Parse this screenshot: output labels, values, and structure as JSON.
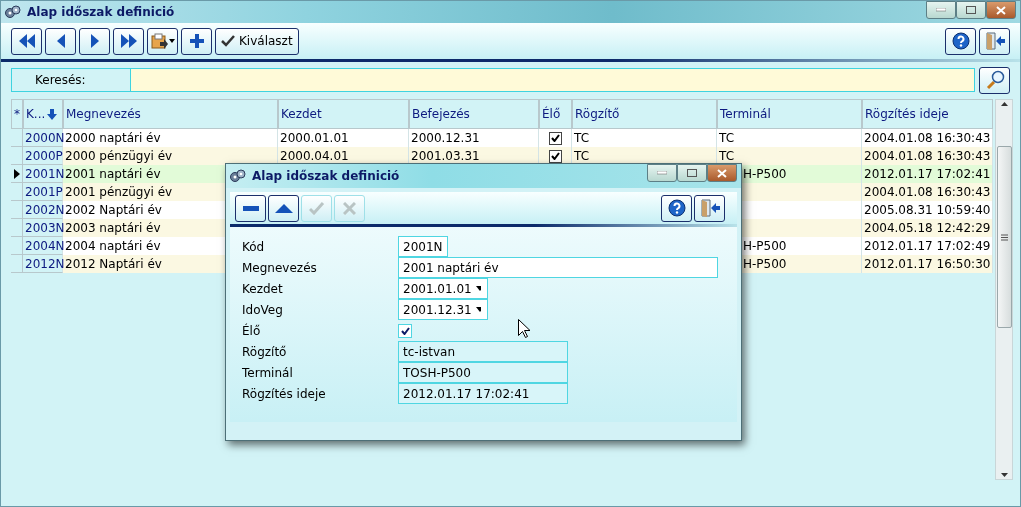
{
  "window": {
    "title": "Alap időszak definició"
  },
  "toolbar": {
    "buttons": [
      {
        "kind": "first"
      },
      {
        "kind": "prev"
      },
      {
        "kind": "next"
      },
      {
        "kind": "last"
      },
      {
        "kind": "print"
      },
      {
        "kind": "add"
      },
      {
        "kind": "select",
        "label": "Kiválaszt"
      }
    ],
    "right_buttons": [
      {
        "kind": "help"
      },
      {
        "kind": "exit"
      }
    ]
  },
  "search": {
    "label": "Keresés:"
  },
  "table": {
    "columns": [
      {
        "label": "*"
      },
      {
        "label": "K...",
        "sorted": true
      },
      {
        "label": "Megnevezés",
        "sorted": false
      },
      {
        "label": "Kezdet",
        "sorted": false
      },
      {
        "label": "Befejezés",
        "sorted": false
      },
      {
        "label": "Élő",
        "sorted": false
      },
      {
        "label": "Rögzítő",
        "sorted": false
      },
      {
        "label": "Terminál",
        "sorted": false
      },
      {
        "label": "Rögzítés ideje",
        "sorted": false
      }
    ],
    "rows": [
      {
        "selected": false,
        "code": "2000N",
        "name": "2000 naptári év",
        "start": "2000.01.01",
        "end": "2000.12.31",
        "live": true,
        "recorder": "TC",
        "terminal": "TC",
        "terminal_cut": false,
        "recorded_at": "2004.01.08 16:30:43"
      },
      {
        "selected": false,
        "code": "2000P",
        "name": "2000 pénzügyi év",
        "start": "2000.04.01",
        "end": "2001.03.31",
        "live": true,
        "recorder": "TC",
        "terminal": "TC",
        "terminal_cut": false,
        "recorded_at": "2004.01.08 16:30:43"
      },
      {
        "selected": true,
        "code": "2001N",
        "name": "2001 naptári év",
        "terminal": "H-P500",
        "terminal_cut": true,
        "recorded_at": "2012.01.17 17:02:41"
      },
      {
        "selected": false,
        "code": "2001P",
        "name": "2001 pénzügyi év",
        "recorded_at": "2004.01.08 16:30:43"
      },
      {
        "selected": false,
        "code": "2002N",
        "name": "2002 Naptári év",
        "recorded_at": "2005.08.31 10:59:40"
      },
      {
        "selected": false,
        "code": "2003N",
        "name": "2003 naptári év",
        "recorded_at": "2004.05.18 12:42:29"
      },
      {
        "selected": false,
        "code": "2004N",
        "name": "2004 naptári év",
        "terminal": "H-P500",
        "terminal_cut": true,
        "recorded_at": "2012.01.17 17:02:49"
      },
      {
        "selected": false,
        "code": "2012N",
        "name": "2012 Naptári év",
        "terminal": "H-P500",
        "terminal_cut": true,
        "recorded_at": "2012.01.17 16:50:30"
      }
    ]
  },
  "dialog": {
    "title": "Alap időszak definició",
    "toolbar": [
      {
        "kind": "minus",
        "disabled": false
      },
      {
        "kind": "up",
        "disabled": false
      },
      {
        "kind": "ok",
        "disabled": true
      },
      {
        "kind": "cancel",
        "disabled": true
      }
    ],
    "right_buttons": [
      {
        "kind": "help"
      },
      {
        "kind": "exit"
      }
    ],
    "fields": [
      {
        "kind": "code",
        "label": "Kód",
        "value": "2001N"
      },
      {
        "kind": "text",
        "label": "Megnevezés",
        "value": "2001 naptári év"
      },
      {
        "kind": "date",
        "label": "Kezdet",
        "value": "2001.01.01"
      },
      {
        "kind": "date",
        "label": "IdoVeg",
        "value": "2001.12.31"
      },
      {
        "kind": "check",
        "label": "Élő",
        "checked": true
      },
      {
        "kind": "readonly",
        "label": "Rögzítő",
        "value": "tc-istvan"
      },
      {
        "kind": "readonly",
        "label": "Terminál",
        "value": "TOSH-P500"
      },
      {
        "kind": "readonly",
        "label": "Rögzítés ideje",
        "value": "2012.01.17 17:02:41"
      }
    ]
  }
}
